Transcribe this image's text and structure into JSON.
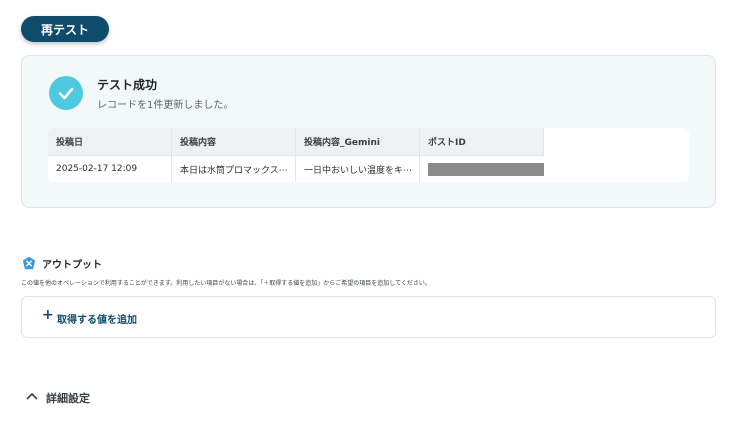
{
  "retest_button": {
    "label": "再テスト"
  },
  "result": {
    "title": "テスト成功",
    "subtitle": "レコードを1件更新しました。",
    "table": {
      "headers": [
        "投稿日",
        "投稿内容",
        "投稿内容_Gemini",
        "ポストID"
      ],
      "row": [
        "2025-02-17 12:09",
        "本日は水筒プロマックス⋯",
        "一日中おいしい温度をキ⋯",
        ""
      ]
    }
  },
  "output": {
    "title": "アウトプット",
    "description": "この値を他のオペレーションで利用することができます。利用したい項目がない場合は、「＋取得する値を追加」からご希望の項目を追加してください。",
    "add_label": "取得する値を追加"
  },
  "details": {
    "label": "詳細設定"
  },
  "icons": {
    "success": "check-circle-icon",
    "output": "output-badge-icon",
    "add": "plus-icon",
    "toggle": "chevron-up-icon"
  },
  "colors": {
    "primary": "#0f4c6b",
    "success": "#4fc9de",
    "card_bg": "#f3f9f9",
    "masked": "#8a8a8a"
  }
}
